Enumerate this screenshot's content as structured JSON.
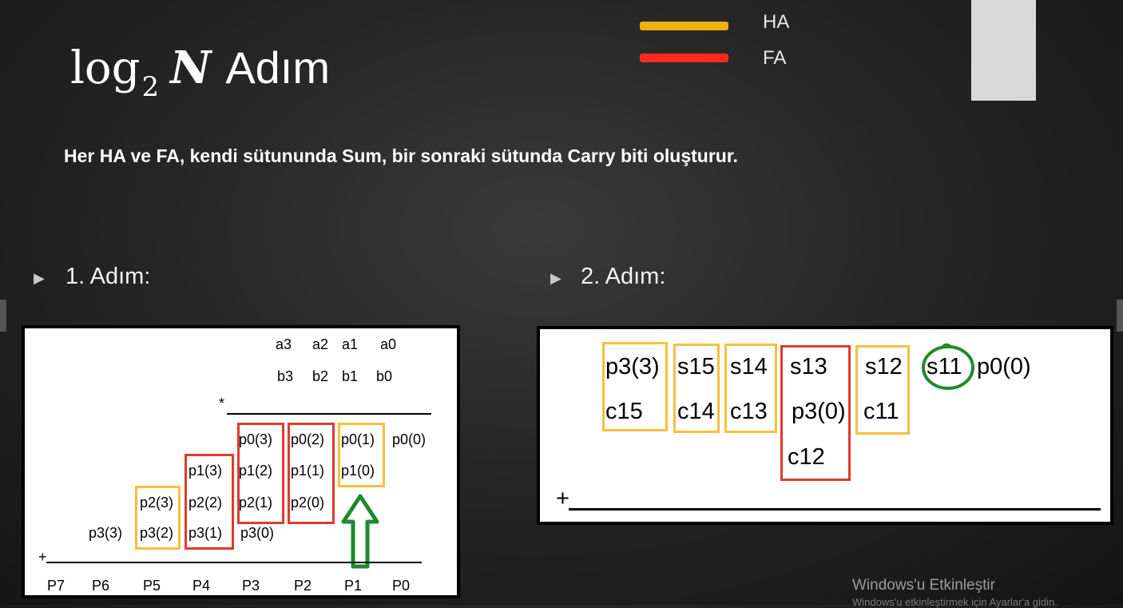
{
  "slide": {
    "title_log": "log",
    "title_sub": "2",
    "title_n": "N",
    "title_word": "Adım",
    "description": "Her HA ve FA, kendi sütununda Sum, bir sonraki sütunda Carry biti oluşturur."
  },
  "legend": [
    {
      "label": "HA",
      "color": "#f0b010"
    },
    {
      "label": "FA",
      "color": "#ff2a1a"
    }
  ],
  "steps": {
    "step1_label": "1. Adım:",
    "step2_label": "2. Adım:",
    "bullet_icon": "play-triangle-icon"
  },
  "step1": {
    "a_row": [
      "a3",
      "a2",
      "a1",
      "a0"
    ],
    "b_row": [
      "b3",
      "b2",
      "b1",
      "b0"
    ],
    "mult_sign": "*",
    "plus_sign": "+",
    "row1": [
      "p0(3)",
      "p0(2)",
      "p0(1)",
      "p0(0)"
    ],
    "row2": [
      "p1(3)",
      "p1(2)",
      "p1(1)",
      "p1(0)"
    ],
    "row3": [
      "p2(3)",
      "p2(2)",
      "p2(1)",
      "p2(0)"
    ],
    "row4": [
      "p3(3)",
      "p3(2)",
      "p3(1)",
      "p3(0)"
    ],
    "result": [
      "P7",
      "P6",
      "P5",
      "P4",
      "P3",
      "P2",
      "P1",
      "P0"
    ],
    "arrow_icon": "green-up-arrow-icon"
  },
  "step2": {
    "row1": [
      "p3(3)",
      "s15",
      "s14",
      "s13",
      "s12",
      "s11",
      "p0(0)"
    ],
    "row2": [
      "c15",
      "c14",
      "c13",
      "p3(0)",
      "c11"
    ],
    "row3": [
      "c12"
    ],
    "plus_sign": "+"
  },
  "watermark": {
    "title": "Windows'u Etkinleştir",
    "subtitle": "Windows'u etkinleştirmek için Ayarlar'a gidin."
  },
  "colors": {
    "ha_box": "#f7c03a",
    "fa_box": "#e23a2b",
    "highlight": "#1e8a2e"
  }
}
